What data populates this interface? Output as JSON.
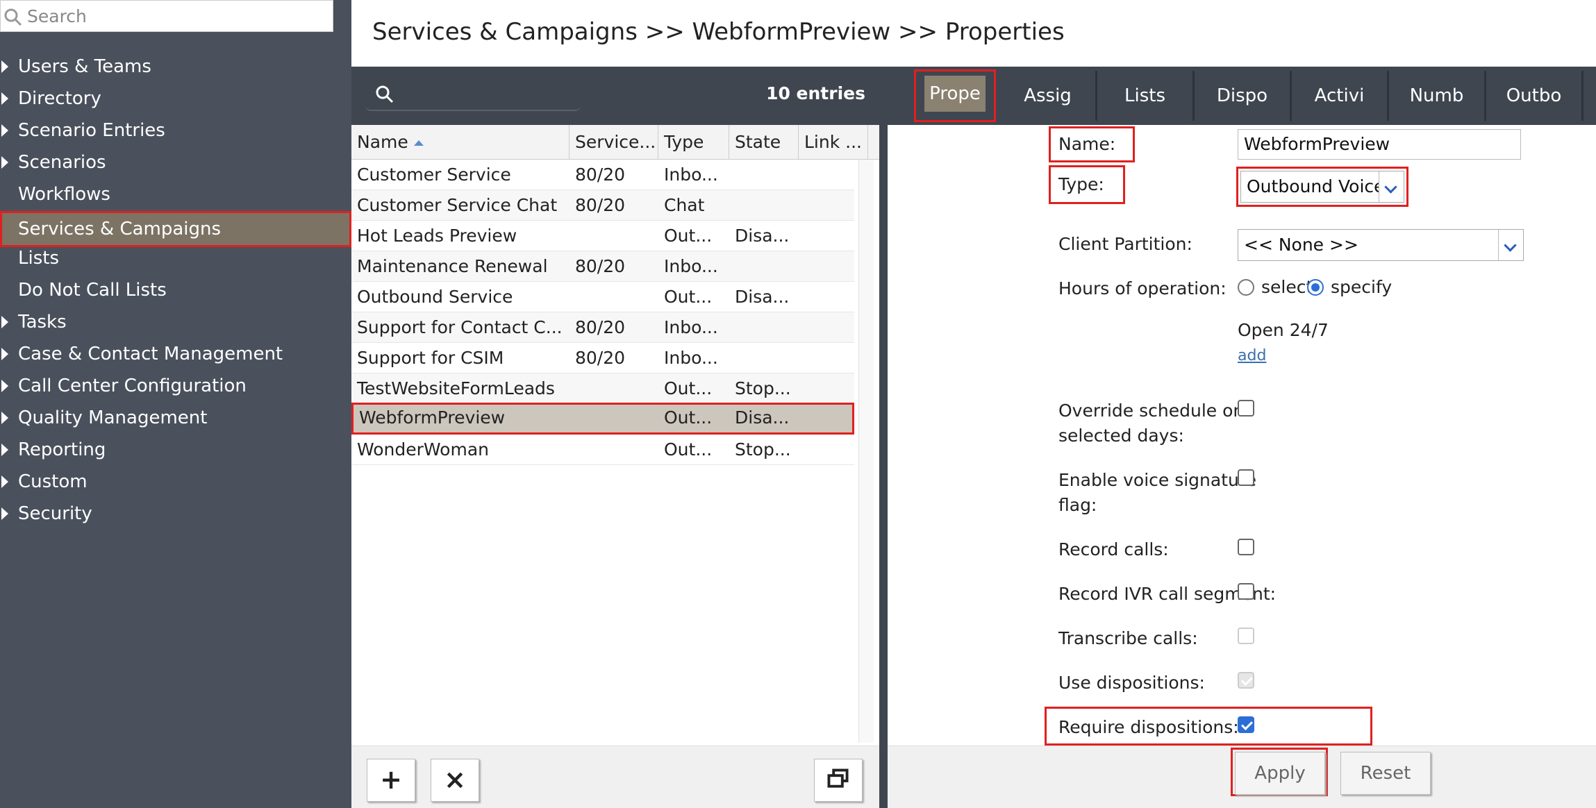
{
  "sidebar": {
    "search_placeholder": "Search",
    "items": [
      {
        "label": "Users & Teams",
        "expandable": true
      },
      {
        "label": "Directory",
        "expandable": true
      },
      {
        "label": "Scenario Entries",
        "expandable": true
      },
      {
        "label": "Scenarios",
        "expandable": true
      },
      {
        "label": "Workflows",
        "expandable": false
      },
      {
        "label": "Services & Campaigns",
        "expandable": false,
        "active": true
      },
      {
        "label": "Lists",
        "expandable": false
      },
      {
        "label": "Do Not Call Lists",
        "expandable": false
      },
      {
        "label": "Tasks",
        "expandable": true
      },
      {
        "label": "Case & Contact Management",
        "expandable": true
      },
      {
        "label": "Call Center Configuration",
        "expandable": true
      },
      {
        "label": "Quality Management",
        "expandable": true
      },
      {
        "label": "Reporting",
        "expandable": true
      },
      {
        "label": "Custom",
        "expandable": true
      },
      {
        "label": "Security",
        "expandable": true
      }
    ]
  },
  "header": {
    "title": "Services & Campaigns >> WebformPreview >> Properties"
  },
  "list": {
    "entries_label": "10 entries",
    "columns": [
      "Name",
      "Service...",
      "Type",
      "State",
      "Link ..."
    ],
    "rows": [
      {
        "name": "Customer Service",
        "service": "80/20",
        "type": "Inbo...",
        "state": ""
      },
      {
        "name": "Customer Service Chat",
        "service": "80/20",
        "type": "Chat",
        "state": ""
      },
      {
        "name": "Hot Leads Preview",
        "service": "",
        "type": "Out...",
        "state": "Disa..."
      },
      {
        "name": "Maintenance Renewal",
        "service": "80/20",
        "type": "Inbo...",
        "state": ""
      },
      {
        "name": "Outbound Service",
        "service": "",
        "type": "Out...",
        "state": "Disa..."
      },
      {
        "name": "Support for Contact C...",
        "service": "80/20",
        "type": "Inbo...",
        "state": ""
      },
      {
        "name": "Support for CSIM",
        "service": "80/20",
        "type": "Inbo...",
        "state": ""
      },
      {
        "name": "TestWebsiteFormLeads",
        "service": "",
        "type": "Out...",
        "state": "Stop..."
      },
      {
        "name": "WebformPreview",
        "service": "",
        "type": "Out...",
        "state": "Disa...",
        "selected": true
      },
      {
        "name": "WonderWoman",
        "service": "",
        "type": "Out...",
        "state": "Stop..."
      }
    ],
    "footer": {
      "add": "+",
      "delete": "×"
    }
  },
  "tabs": [
    "Prope",
    "Assig",
    "Lists",
    "Dispo",
    "Activi",
    "Numb",
    "Outbo"
  ],
  "props": {
    "name_label": "Name:",
    "name_value": "WebformPreview",
    "type_label": "Type:",
    "type_value": "Outbound Voice",
    "partition_label": "Client Partition:",
    "partition_value": "<< None >>",
    "hours_label": "Hours of operation:",
    "hours_select": "select",
    "hours_specify": "specify",
    "hours_selected": "specify",
    "open_label": "Open 24/7",
    "add_link": "add",
    "override_label_1": "Override schedule on",
    "override_label_2": "selected days:",
    "voice_sig_label_1": "Enable voice signature",
    "voice_sig_label_2": "flag:",
    "record_calls_label": "Record calls:",
    "record_ivr_label": "Record IVR call segment:",
    "transcribe_label": "Transcribe calls:",
    "use_disp_label": "Use dispositions:",
    "require_disp_label": "Require dispositions:"
  },
  "buttons": {
    "apply": "Apply",
    "reset": "Reset"
  },
  "colors": {
    "accent_blue": "#2b6fd6",
    "highlight_red": "#e02020",
    "sidebar_active": "#7c7364"
  }
}
